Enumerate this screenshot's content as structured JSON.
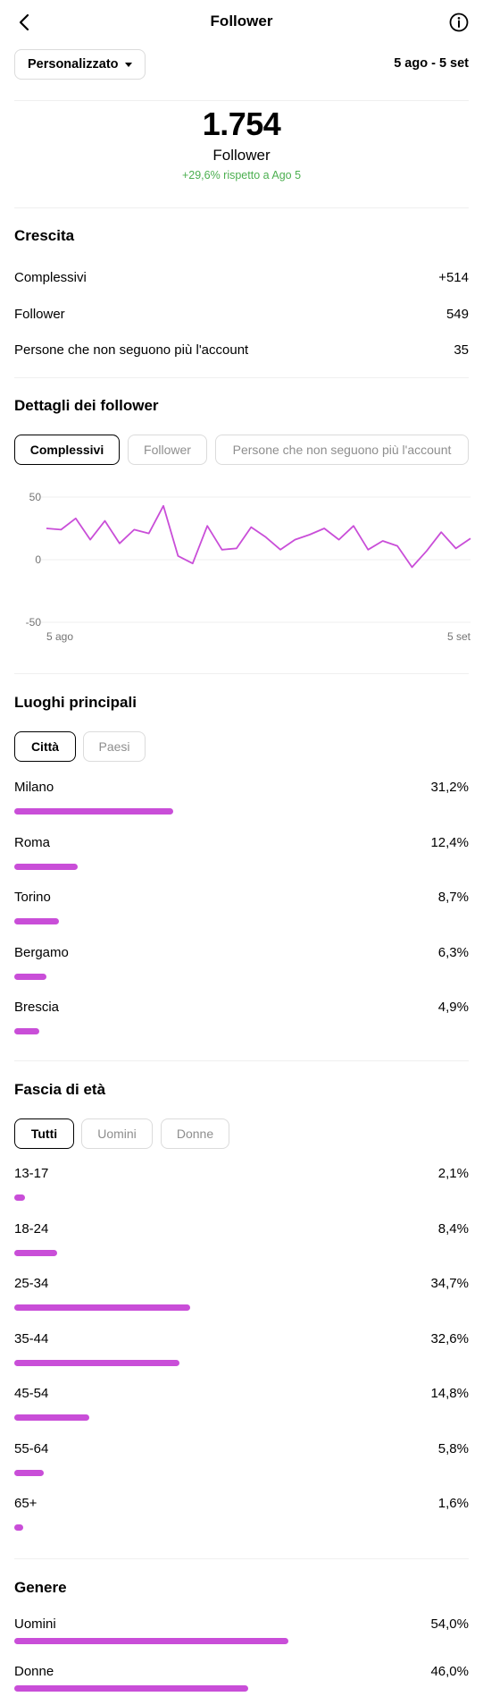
{
  "header": {
    "title": "Follower",
    "back_icon": "back-arrow-icon",
    "info_icon": "info-icon"
  },
  "filter": {
    "range_label": "Personalizzato",
    "date_range": "5 ago - 5 set"
  },
  "summary": {
    "total": "1.754",
    "label": "Follower",
    "delta": "+29,6% rispetto a Ago 5"
  },
  "growth": {
    "title": "Crescita",
    "rows": [
      {
        "label": "Complessivi",
        "value": "+514"
      },
      {
        "label": "Follower",
        "value": "549"
      },
      {
        "label": "Persone che non seguono più l'account",
        "value": "35"
      }
    ]
  },
  "details": {
    "title": "Dettagli dei follower",
    "tabs": [
      "Complessivi",
      "Follower",
      "Persone che non seguono più l'account"
    ]
  },
  "chart_data": {
    "type": "line",
    "y_ticks": [
      "50",
      "0",
      "-50"
    ],
    "ylim": [
      -50,
      50
    ],
    "x_labels": [
      "5 ago",
      "5 set"
    ],
    "color": "#c94ed8",
    "grid": true,
    "series": [
      {
        "values": [
          25,
          24,
          33,
          16,
          31,
          13,
          24,
          21,
          43,
          3,
          -3,
          27,
          8,
          9,
          26,
          18,
          8,
          16,
          20,
          25,
          16,
          27,
          8,
          15,
          11,
          -6,
          7,
          22,
          9,
          17
        ]
      }
    ]
  },
  "locations": {
    "title": "Luoghi principali",
    "tabs": [
      "Città",
      "Paesi"
    ],
    "rows": [
      {
        "label": "Milano",
        "value": "31,2%",
        "fraction": 0.312
      },
      {
        "label": "Roma",
        "value": "12,4%",
        "fraction": 0.124
      },
      {
        "label": "Torino",
        "value": "8,7%",
        "fraction": 0.087
      },
      {
        "label": "Bergamo",
        "value": "6,3%",
        "fraction": 0.063
      },
      {
        "label": "Brescia",
        "value": "4,9%",
        "fraction": 0.049
      }
    ]
  },
  "age": {
    "title": "Fascia di età",
    "tabs": [
      "Tutti",
      "Uomini",
      "Donne"
    ],
    "rows": [
      {
        "label": "13-17",
        "value": "2,1%",
        "fraction": 0.021
      },
      {
        "label": "18-24",
        "value": "8,4%",
        "fraction": 0.084
      },
      {
        "label": "25-34",
        "value": "34,7%",
        "fraction": 0.347
      },
      {
        "label": "35-44",
        "value": "32,6%",
        "fraction": 0.326
      },
      {
        "label": "45-54",
        "value": "14,8%",
        "fraction": 0.148
      },
      {
        "label": "55-64",
        "value": "5,8%",
        "fraction": 0.058
      },
      {
        "label": "65+",
        "value": "1,6%",
        "fraction": 0.016
      }
    ]
  },
  "gender": {
    "title": "Genere",
    "rows": [
      {
        "label": "Uomini",
        "value": "54,0%",
        "fraction": 0.54
      },
      {
        "label": "Donne",
        "value": "46,0%",
        "fraction": 0.46
      }
    ]
  }
}
